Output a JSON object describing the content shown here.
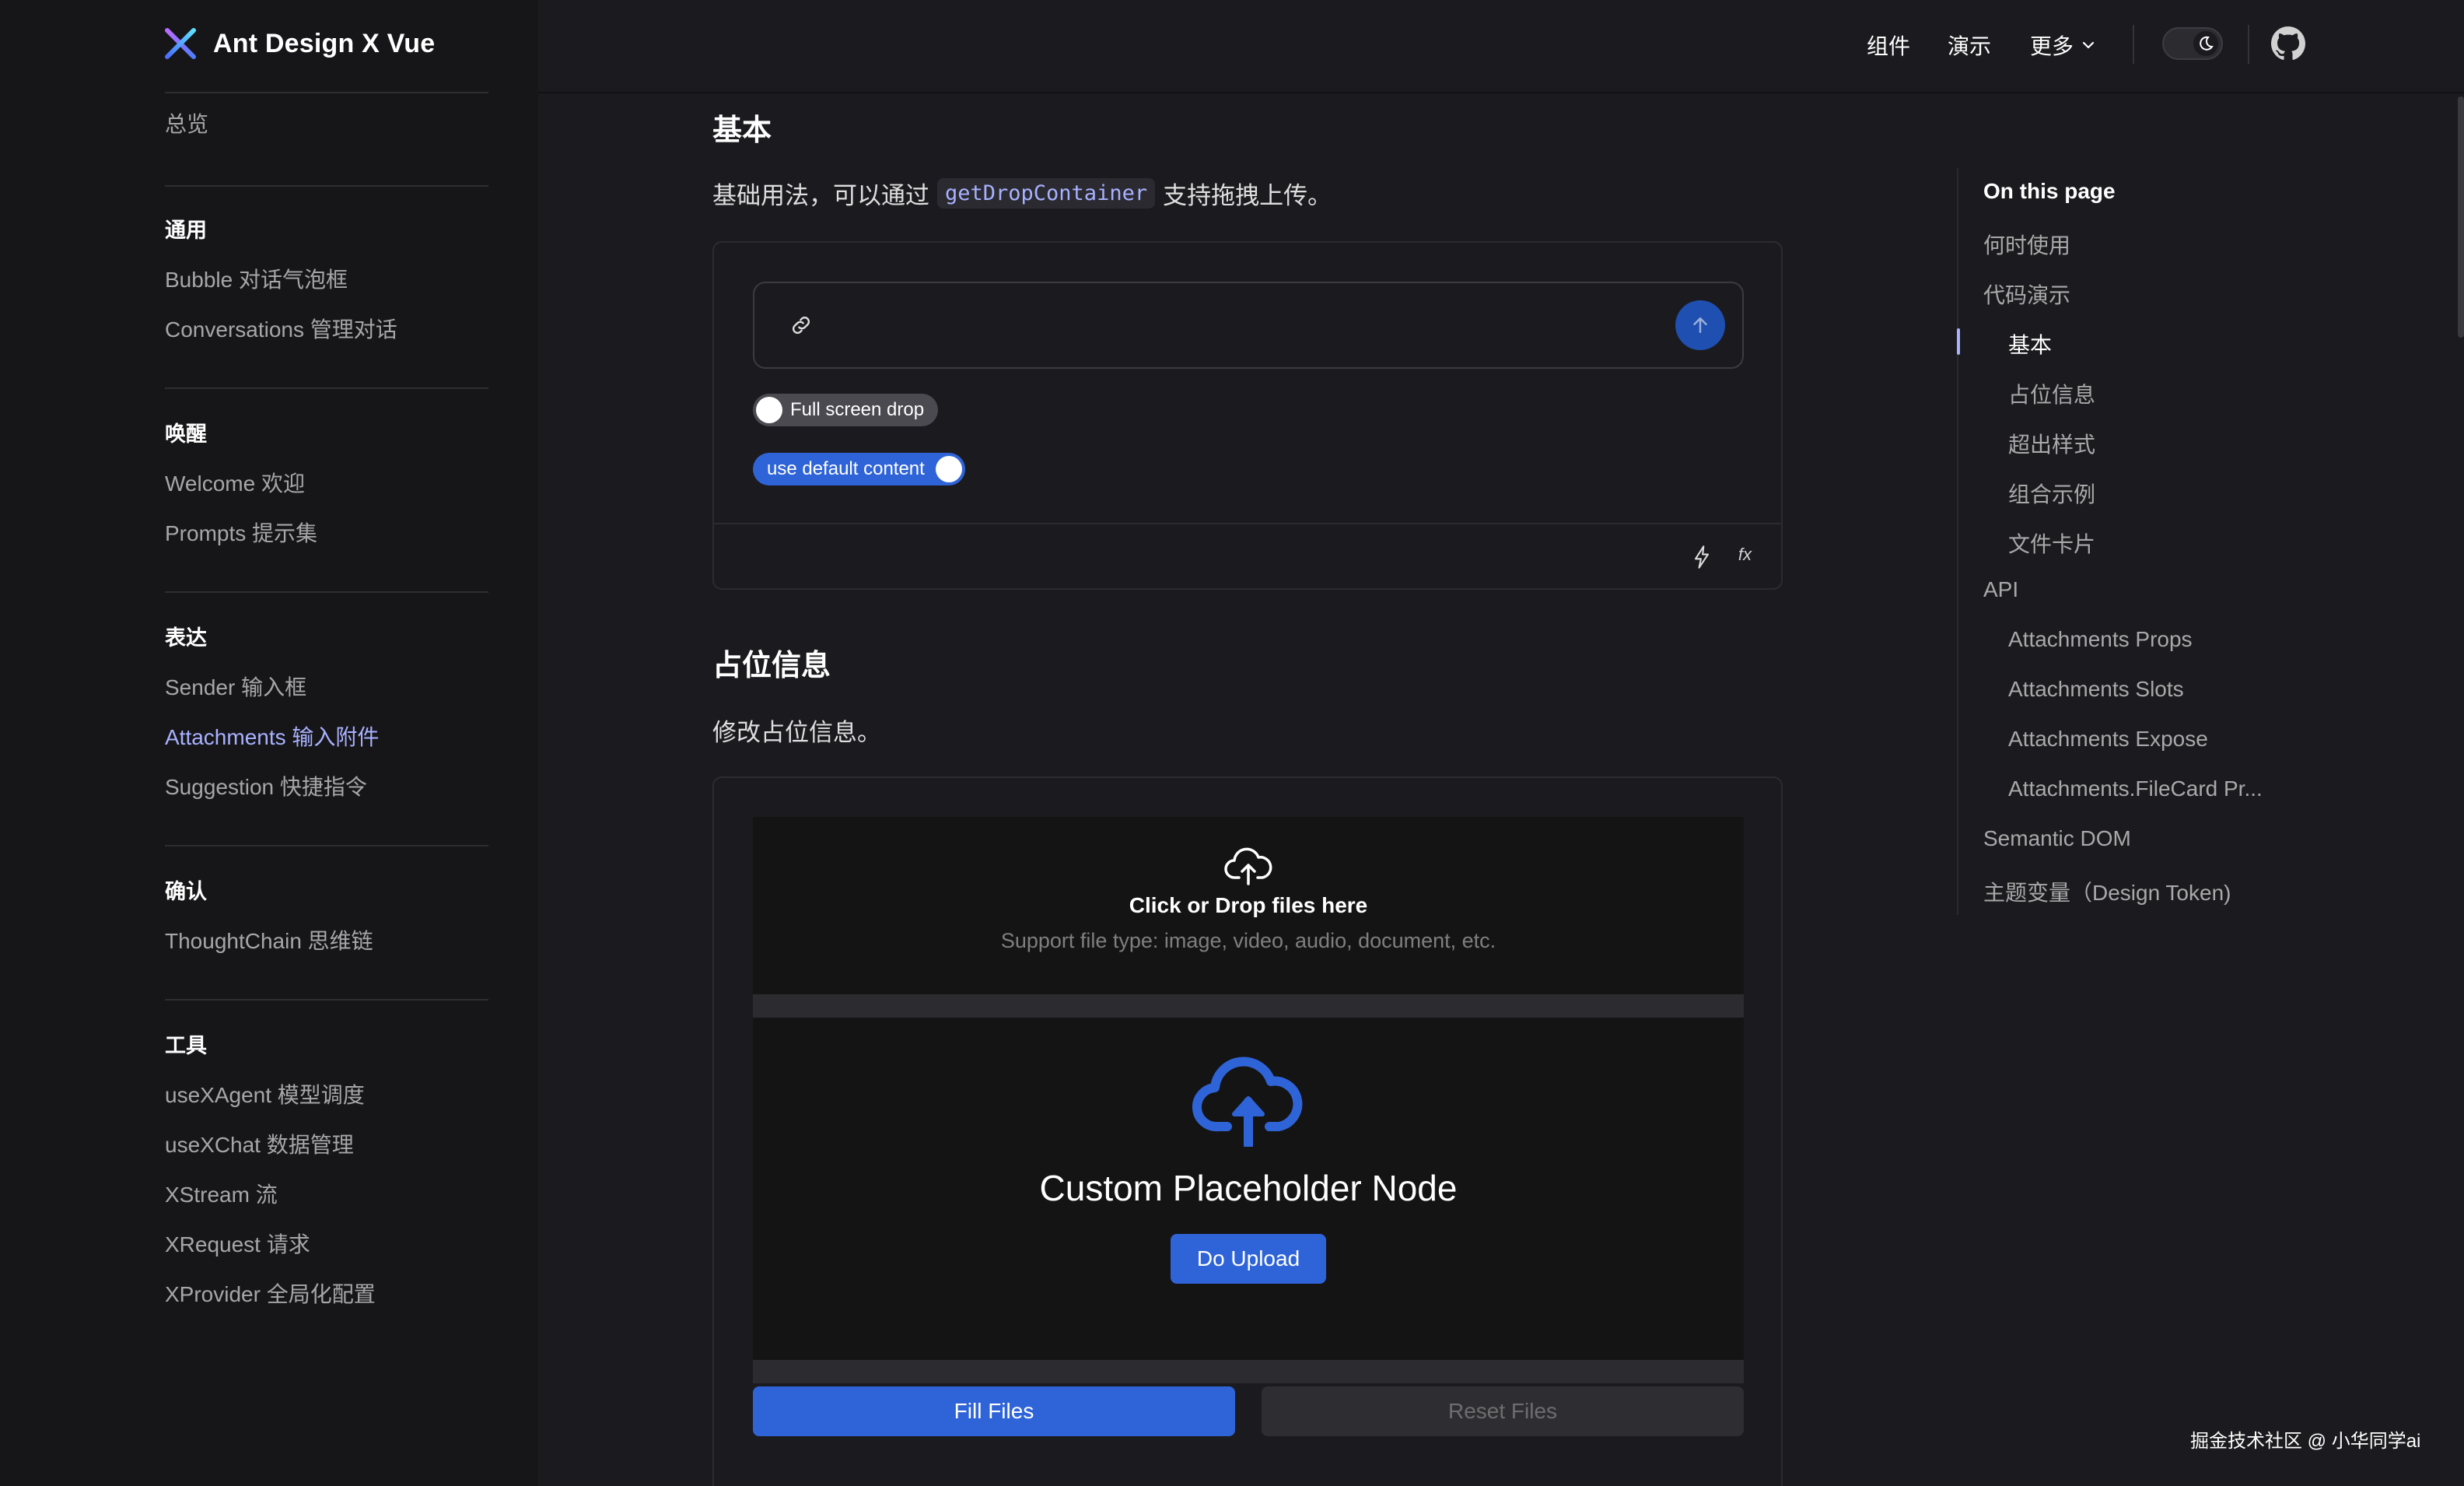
{
  "brand": {
    "title": "Ant Design X Vue"
  },
  "sidebar": {
    "overview": "总览",
    "groups": [
      {
        "label": "通用",
        "items": [
          {
            "label": "Bubble 对话气泡框"
          },
          {
            "label": "Conversations 管理对话"
          }
        ]
      },
      {
        "label": "唤醒",
        "items": [
          {
            "label": "Welcome 欢迎"
          },
          {
            "label": "Prompts 提示集"
          }
        ]
      },
      {
        "label": "表达",
        "items": [
          {
            "label": "Sender 输入框"
          },
          {
            "label": "Attachments 输入附件",
            "active": true
          },
          {
            "label": "Suggestion 快捷指令"
          }
        ]
      },
      {
        "label": "确认",
        "items": [
          {
            "label": "ThoughtChain 思维链"
          }
        ]
      },
      {
        "label": "工具",
        "items": [
          {
            "label": "useXAgent 模型调度"
          },
          {
            "label": "useXChat 数据管理"
          },
          {
            "label": "XStream 流"
          },
          {
            "label": "XRequest 请求"
          },
          {
            "label": "XProvider 全局化配置"
          }
        ]
      }
    ]
  },
  "topnav": {
    "components": "组件",
    "demos": "演示",
    "more": "更多",
    "theme_icon": "moon-icon",
    "github_icon": "github-icon"
  },
  "main": {
    "basic": {
      "heading": "基本",
      "desc_before": "基础用法，可以通过",
      "desc_code": "getDropContainer",
      "desc_after": "支持拖拽上传。",
      "switch_fullscreen": {
        "label": "Full screen drop",
        "checked": false
      },
      "switch_default": {
        "label": "use default content",
        "checked": true
      },
      "action_icon_1": "thunderbolt-icon",
      "action_icon_2": "fx"
    },
    "placeholder": {
      "heading": "占位信息",
      "desc": "修改占位信息。",
      "drop_title": "Click or Drop files here",
      "drop_desc": "Support file type: image, video, audio, document, etc.",
      "node_title": "Custom Placeholder Node",
      "upload_button": "Do Upload",
      "fill_button": "Fill Files",
      "reset_button": "Reset Files"
    }
  },
  "toc": {
    "title": "On this page",
    "items": [
      {
        "label": "何时使用",
        "level": 1
      },
      {
        "label": "代码演示",
        "level": 1
      },
      {
        "label": "基本",
        "level": 2,
        "active": true
      },
      {
        "label": "占位信息",
        "level": 2
      },
      {
        "label": "超出样式",
        "level": 2
      },
      {
        "label": "组合示例",
        "level": 2
      },
      {
        "label": "文件卡片",
        "level": 2
      },
      {
        "label": "API",
        "level": 1
      },
      {
        "label": "Attachments Props",
        "level": 2
      },
      {
        "label": "Attachments Slots",
        "level": 2
      },
      {
        "label": "Attachments Expose",
        "level": 2
      },
      {
        "label": "Attachments.FileCard Pr...",
        "level": 2
      },
      {
        "label": "Semantic DOM",
        "level": 1
      },
      {
        "label": "主题变量（Design Token)",
        "level": 1
      }
    ]
  },
  "watermark": "掘金技术社区 @ 小华同学ai",
  "colors": {
    "accent": "#a8b1ff",
    "primary": "#2f64d8",
    "background": "#1b1b1f",
    "sidebar": "#161618"
  }
}
